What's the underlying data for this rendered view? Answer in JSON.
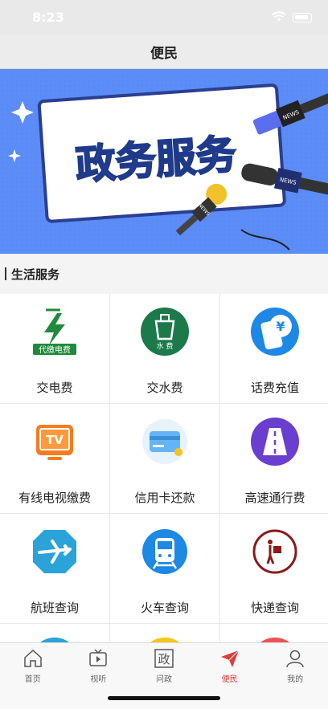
{
  "status_bar": {
    "time": "8:23"
  },
  "nav": {
    "title": "便民"
  },
  "banner": {
    "headline": "政务服务",
    "mic_label_1": "NEWS",
    "mic_label_2": "NEWS",
    "mic_label_3": "NEWS"
  },
  "section": {
    "title": "生活服务"
  },
  "services": [
    {
      "label": "交电费",
      "icon": "electricity-icon",
      "badge": "代缴电费",
      "color": "#1f8a3b"
    },
    {
      "label": "交水费",
      "icon": "water-icon",
      "badge": "水 费",
      "color": "#1c7a4a"
    },
    {
      "label": "话费充值",
      "icon": "phone-recharge-icon",
      "color": "#1e88e5"
    },
    {
      "label": "有线电视缴费",
      "icon": "tv-icon",
      "badge": "TV",
      "color": "#f57c1f"
    },
    {
      "label": "信用卡还款",
      "icon": "credit-card-icon",
      "color": "#64b5f6"
    },
    {
      "label": "高速通行费",
      "icon": "highway-icon",
      "color": "#6a3fd0"
    },
    {
      "label": "航班查询",
      "icon": "airplane-icon",
      "color": "#29a3d8"
    },
    {
      "label": "火车查询",
      "icon": "train-icon",
      "color": "#1e88e5"
    },
    {
      "label": "快递查询",
      "icon": "delivery-icon",
      "color": "#8b1a1a"
    },
    {
      "label": "",
      "icon": "partial-blue-icon",
      "color": "#29a3d8"
    },
    {
      "label": "",
      "icon": "partial-yellow-icon",
      "color": "#f5c518"
    },
    {
      "label": "",
      "icon": "partial-red-icon",
      "color": "#ef5350"
    }
  ],
  "tabs": [
    {
      "label": "首页",
      "icon": "home-icon",
      "active": false
    },
    {
      "label": "视听",
      "icon": "tv-play-icon",
      "active": false
    },
    {
      "label": "问政",
      "icon": "zheng-icon",
      "glyph": "政",
      "active": false
    },
    {
      "label": "便民",
      "icon": "paper-plane-icon",
      "active": true
    },
    {
      "label": "我的",
      "icon": "person-icon",
      "active": false
    }
  ]
}
